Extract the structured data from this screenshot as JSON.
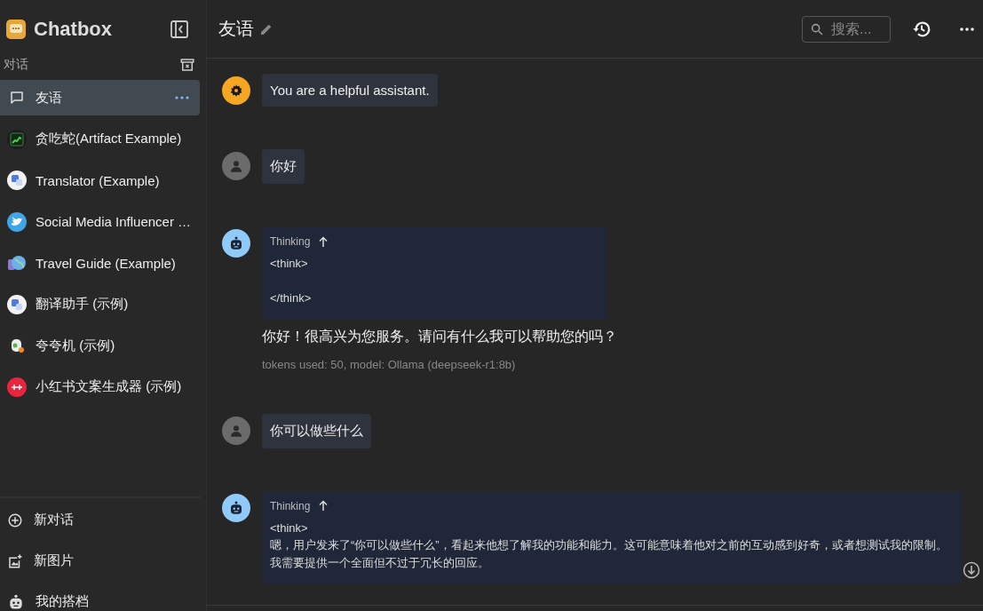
{
  "sidebar": {
    "app_name": "Chatbox",
    "section_label": "对话",
    "items": [
      {
        "label": "友语",
        "selected": true
      },
      {
        "label": "贪吃蛇(Artifact Example)",
        "selected": false
      },
      {
        "label": "Translator (Example)",
        "selected": false
      },
      {
        "label": "Social Media Influencer …",
        "selected": false
      },
      {
        "label": "Travel Guide (Example)",
        "selected": false
      },
      {
        "label": "翻译助手 (示例)",
        "selected": false
      },
      {
        "label": "夸夸机 (示例)",
        "selected": false
      },
      {
        "label": "小红书文案生成器 (示例)",
        "selected": false
      }
    ],
    "actions": [
      {
        "label": "新对话"
      },
      {
        "label": "新图片"
      },
      {
        "label": "我的搭档"
      }
    ]
  },
  "header": {
    "title": "友语",
    "search": {
      "placeholder": "搜索..."
    }
  },
  "messages": [
    {
      "kind": "system",
      "text": "You are a helpful assistant."
    },
    {
      "kind": "user",
      "text": "你好"
    },
    {
      "kind": "assistant",
      "thinking": {
        "label": "Thinking",
        "text": "<think>\n\n</think>"
      },
      "text": "你好！很高兴为您服务。请问有什么我可以帮助您的吗？",
      "meta": "tokens used: 50, model: Ollama (deepseek-r1:8b)"
    },
    {
      "kind": "user",
      "text": "你可以做些什么"
    },
    {
      "kind": "assistant",
      "thinking": {
        "label": "Thinking",
        "text": "<think>\n嗯，用户发来了“你可以做些什么”，看起来他想了解我的功能和能力。这可能意味着他对之前的互动感到好奇，或者想测试我的限制。我需要提供一个全面但不过于冗长的回应。"
      }
    }
  ]
}
